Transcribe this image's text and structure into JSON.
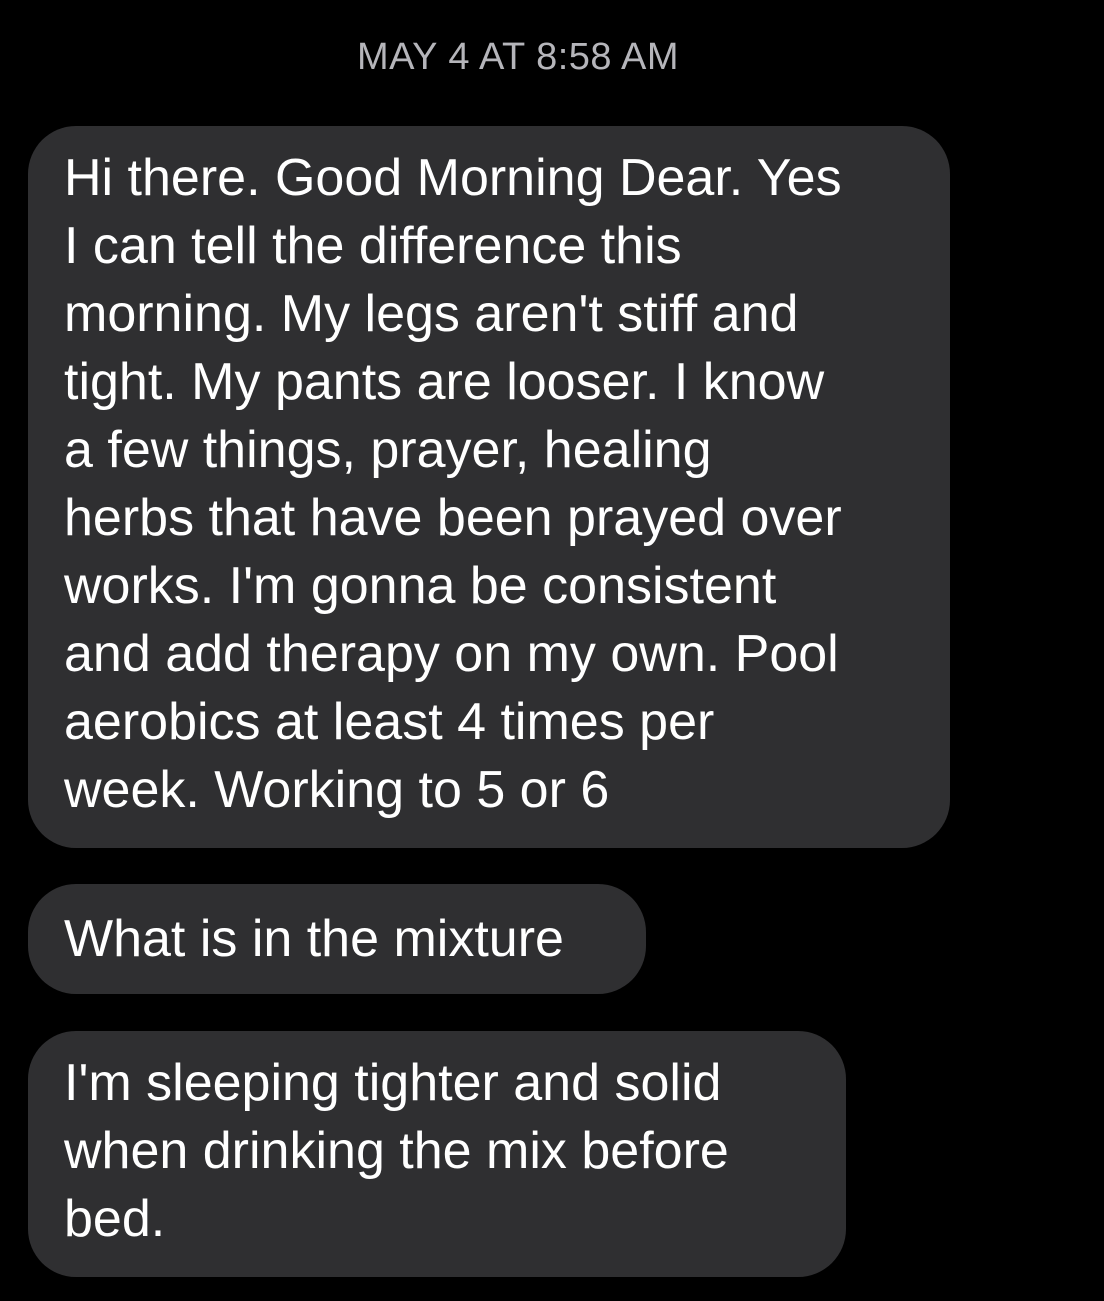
{
  "thread": {
    "timestamp": "MAY 4 AT 8:58 AM",
    "messages": [
      {
        "text": "Hi there. Good Morning Dear. Yes\nI can tell the difference this\nmorning. My legs aren't stiff and\ntight. My pants are looser. I know\na few things, prayer, healing\nherbs that have been prayed over\nworks. I'm gonna be consistent\nand add therapy on my own. Pool\naerobics at least 4 times per\nweek. Working to 5 or 6"
      },
      {
        "text": "What is in the mixture"
      },
      {
        "text": "I'm sleeping tighter and solid\nwhen drinking the mix before\nbed."
      }
    ]
  },
  "colors": {
    "background": "#000000",
    "bubble": "#2f2f31",
    "timestamp_text": "#b5b5ba",
    "message_text": "#ffffff"
  }
}
